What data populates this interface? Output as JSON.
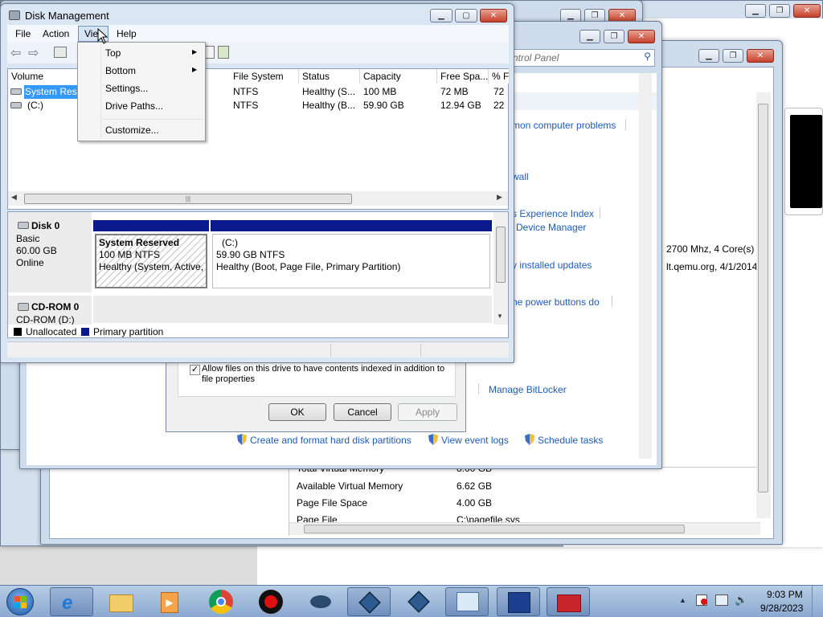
{
  "bg_window_far": {
    "cpu": "2700 Mhz, 4 Core(s)",
    "bios": "lt.qemu.org, 4/1/2014"
  },
  "control_panel": {
    "search_placeholder": "ntrol Panel",
    "links": [
      "mon computer problems",
      "wall",
      "s Experience Index",
      "Device Manager",
      "y installed updates",
      "he power buttons do",
      "Manage BitLocker"
    ],
    "bottom_links": [
      "Create and format hard disk partitions",
      "View event logs",
      "Schedule tasks"
    ],
    "sysinfo": [
      {
        "label": "Total Virtual Memory",
        "value": "8.00 GB"
      },
      {
        "label": "Available Virtual Memory",
        "value": "6.62 GB"
      },
      {
        "label": "Page File Space",
        "value": "4.00 GB"
      },
      {
        "label": "Page File",
        "value": "C:\\pagefile.sys"
      }
    ]
  },
  "properties_dialog": {
    "index_checkbox_label": "Allow files on this drive to have contents indexed in addition to file properties",
    "ok": "OK",
    "cancel": "Cancel",
    "apply": "Apply"
  },
  "disk_mgmt": {
    "title": "Disk Management",
    "menu": [
      "File",
      "Action",
      "View",
      "Help"
    ],
    "view_menu": {
      "items": [
        "Top",
        "Bottom",
        "Settings...",
        "Drive Paths...",
        "Customize..."
      ]
    },
    "columns": [
      "Volume",
      "File System",
      "Status",
      "Capacity",
      "Free Spa...",
      "% F"
    ],
    "volumes": [
      {
        "name": "System Rese",
        "fs": "NTFS",
        "status": "Healthy (S...",
        "capacity": "100 MB",
        "free": "72 MB",
        "pct": "72"
      },
      {
        "name": "(C:)",
        "fs": "NTFS",
        "status": "Healthy (B...",
        "capacity": "59.90 GB",
        "free": "12.94 GB",
        "pct": "22"
      }
    ],
    "disk0": {
      "name": "Disk 0",
      "type": "Basic",
      "size": "60.00 GB",
      "state": "Online",
      "part1": {
        "name": "System Reserved",
        "size": "100 MB NTFS",
        "status": "Healthy (System, Active,"
      },
      "part2": {
        "name": "(C:)",
        "size": "59.90 GB NTFS",
        "status": "Healthy (Boot, Page File, Primary Partition)"
      }
    },
    "cdrom": {
      "name": "CD-ROM 0",
      "drive": "CD-ROM (D:)"
    },
    "legend": [
      "Unallocated",
      "Primary partition"
    ],
    "colors": {
      "primary": "#0a1a8c",
      "unallocated": "#000000",
      "selection": "#3399ff"
    }
  },
  "taskbar": {
    "time": "9:03 PM",
    "date": "9/28/2023"
  }
}
